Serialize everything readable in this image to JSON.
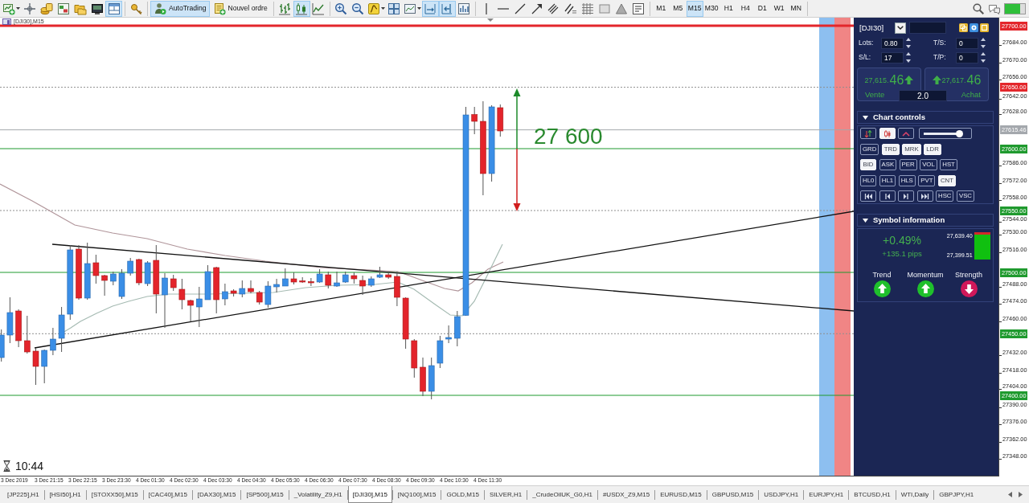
{
  "toolbar": {
    "groups": [
      [
        {
          "kind": "newchart",
          "selected": false
        },
        {
          "kind": "profiles",
          "selected": false
        },
        {
          "kind": "marketwatch",
          "selected": false
        },
        {
          "kind": "datawindow",
          "selected": false
        },
        {
          "kind": "navigator",
          "selected": false
        },
        {
          "kind": "terminal",
          "selected": false
        },
        {
          "kind": "tester",
          "selected": true
        }
      ],
      [
        {
          "kind": "options",
          "selected": false
        }
      ],
      [
        {
          "kind": "autotrading",
          "label": "AutoTrading",
          "selected": true
        },
        {
          "kind": "neworder",
          "label": "Nouvel ordre",
          "selected": false
        }
      ],
      [
        {
          "kind": "barchart",
          "selected": false
        },
        {
          "kind": "candles",
          "selected": true
        },
        {
          "kind": "linechart",
          "selected": false
        }
      ],
      [
        {
          "kind": "zoomin",
          "selected": false
        },
        {
          "kind": "zoomout",
          "selected": false
        },
        {
          "kind": "indicators",
          "selected": false
        },
        {
          "kind": "tile",
          "selected": false
        },
        {
          "kind": "templates",
          "selected": false
        },
        {
          "kind": "autoscroll",
          "selected": true
        },
        {
          "kind": "chartshift",
          "selected": true
        },
        {
          "kind": "properties",
          "selected": false
        }
      ],
      [
        {
          "kind": "vline",
          "selected": false
        },
        {
          "kind": "hline",
          "selected": false
        },
        {
          "kind": "trendline",
          "selected": false
        },
        {
          "kind": "arrow",
          "selected": false
        },
        {
          "kind": "channel",
          "selected": false
        },
        {
          "kind": "fibo",
          "selected": false
        },
        {
          "kind": "fibogrid",
          "selected": false
        },
        {
          "kind": "rectangle",
          "selected": false
        },
        {
          "kind": "triangle",
          "selected": false
        },
        {
          "kind": "text",
          "selected": false
        }
      ]
    ],
    "periods": [
      {
        "label": "M1",
        "selected": false
      },
      {
        "label": "M5",
        "selected": false
      },
      {
        "label": "M15",
        "selected": true
      },
      {
        "label": "M30",
        "selected": false
      },
      {
        "label": "H1",
        "selected": false
      },
      {
        "label": "H4",
        "selected": false
      },
      {
        "label": "D1",
        "selected": false
      },
      {
        "label": "W1",
        "selected": false
      },
      {
        "label": "MN",
        "selected": false
      }
    ]
  },
  "chart": {
    "title": "[DJI30],M15",
    "target_label": "27 600",
    "timer": "10:44",
    "levels": [
      {
        "label": "27700.00",
        "color": "#e3262b",
        "kind": "bold"
      },
      {
        "label": "27650.00",
        "color": "#e3262b",
        "kind": "dotted"
      },
      {
        "label": "27615.46",
        "color": "#a4a8ad",
        "kind": "solid"
      },
      {
        "label": "27600.00",
        "color": "#1f9a2e",
        "kind": "solid"
      },
      {
        "label": "27550.00",
        "color": "#1f9a2e",
        "kind": "dotted"
      },
      {
        "label": "27500.00",
        "color": "#1f9a2e",
        "kind": "solid"
      },
      {
        "label": "27450.00",
        "color": "#1f9a2e",
        "kind": "dotted"
      },
      {
        "label": "27400.00",
        "color": "#1f9a2e",
        "kind": "solid"
      }
    ],
    "price_ticks": [
      "27684.00",
      "27670.00",
      "27656.00",
      "27642.00",
      "27628.00",
      "27586.00",
      "27572.00",
      "27558.00",
      "27544.00",
      "27530.00",
      "27516.00",
      "27488.00",
      "27474.00",
      "27460.00",
      "27432.00",
      "27418.00",
      "27404.00",
      "27390.00",
      "27376.00",
      "27362.00",
      "27348.00"
    ],
    "time_ticks": [
      "3 Dec 2019",
      "3 Dec 21:15",
      "3 Dec 22:15",
      "3 Dec 23:30",
      "4 Dec 01:30",
      "4 Dec 02:30",
      "4 Dec 03:30",
      "4 Dec 04:30",
      "4 Dec 05:30",
      "4 Dec 06:30",
      "4 Dec 07:30",
      "4 Dec 08:30",
      "4 Dec 09:30",
      "4 Dec 10:30",
      "4 Dec 11:30"
    ]
  },
  "panel": {
    "symbol": "[DJI30]",
    "fields": [
      {
        "label": "Lots:",
        "value": "0.80"
      },
      {
        "label": "T/S:",
        "value": "0"
      },
      {
        "label": "S/L:",
        "value": "17"
      },
      {
        "label": "T/P:",
        "value": "0"
      }
    ],
    "sell": {
      "price_main": "27,615.",
      "price_pips": "46",
      "up": true,
      "label": "Vente"
    },
    "buy": {
      "price_main": "27,617.",
      "price_pips": "46",
      "up": true,
      "label": "Achat"
    },
    "volume": "2.0",
    "chart_controls": {
      "title": "Chart controls",
      "expanded": true,
      "rows": [
        [
          {
            "kind": "swap",
            "selected": false
          },
          {
            "kind": "candle",
            "selected": true
          },
          {
            "kind": "caret",
            "selected": false
          },
          {
            "kind": "slider",
            "level": 0.82
          }
        ],
        [
          {
            "kind": "text",
            "label": "GRD",
            "selected": false
          },
          {
            "kind": "text",
            "label": "TRD",
            "selected": true
          },
          {
            "kind": "text",
            "label": "MRK",
            "selected": true
          },
          {
            "kind": "text",
            "label": "LDR",
            "selected": true
          }
        ],
        [
          {
            "kind": "text",
            "label": "BID",
            "selected": true
          },
          {
            "kind": "text",
            "label": "ASK",
            "selected": false
          },
          {
            "kind": "text",
            "label": "PER",
            "selected": false
          },
          {
            "kind": "text",
            "label": "VOL",
            "selected": false
          },
          {
            "kind": "text",
            "label": "HST",
            "selected": false
          }
        ],
        [
          {
            "kind": "text",
            "label": "HL0",
            "selected": false
          },
          {
            "kind": "text",
            "label": "HL1",
            "selected": false
          },
          {
            "kind": "text",
            "label": "HLS",
            "selected": false
          },
          {
            "kind": "text",
            "label": "PVT",
            "selected": false
          },
          {
            "kind": "text",
            "label": "CNT",
            "selected": true
          }
        ],
        [
          {
            "kind": "first",
            "selected": false
          },
          {
            "kind": "prev",
            "selected": false
          },
          {
            "kind": "next",
            "selected": false
          },
          {
            "kind": "last",
            "selected": false
          },
          {
            "kind": "text",
            "label": "HSC",
            "selected": false
          },
          {
            "kind": "text",
            "label": "VSC",
            "selected": false
          }
        ]
      ]
    },
    "symbol_info": {
      "title": "Symbol information",
      "expanded": true,
      "change": "+0.49%",
      "pips": "+135.1 pips",
      "high": "27,639.40",
      "low": "27,399.51",
      "range_bar": {
        "level": 0.9
      },
      "signals": [
        {
          "label": "Trend",
          "up": true
        },
        {
          "label": "Momentum",
          "up": true
        },
        {
          "label": "Strength",
          "up": false
        }
      ]
    }
  },
  "tabs": [
    {
      "label": "[JP225],H1",
      "selected": false
    },
    {
      "label": "[HSI50],H1",
      "selected": false
    },
    {
      "label": "[STOXX50],M15",
      "selected": false
    },
    {
      "label": "[CAC40],M15",
      "selected": false
    },
    {
      "label": "[DAX30],M15",
      "selected": false
    },
    {
      "label": "[SP500],M15",
      "selected": false
    },
    {
      "label": "_Volatility_Z9,H1",
      "selected": false
    },
    {
      "label": "[DJI30],M15",
      "selected": true
    },
    {
      "label": "[NQ100],M15",
      "selected": false
    },
    {
      "label": "GOLD,M15",
      "selected": false
    },
    {
      "label": "SILVER,H1",
      "selected": false
    },
    {
      "label": "_CrudeOilUK_G0,H1",
      "selected": false
    },
    {
      "label": "#USDX_Z9,M15",
      "selected": false
    },
    {
      "label": "EURUSD,M15",
      "selected": false
    },
    {
      "label": "GBPUSD,M15",
      "selected": false
    },
    {
      "label": "USDJPY,H1",
      "selected": false
    },
    {
      "label": "EURJPY,H1",
      "selected": false
    },
    {
      "label": "BTCUSD,H1",
      "selected": false
    },
    {
      "label": "WTI,Daily",
      "selected": false
    },
    {
      "label": "GBPJPY,H1",
      "selected": false
    }
  ]
}
